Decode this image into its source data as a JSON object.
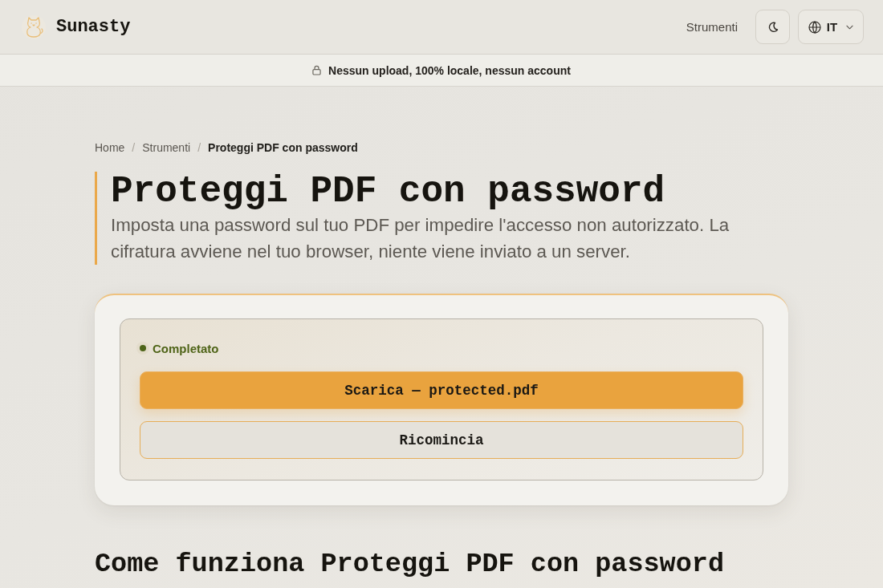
{
  "header": {
    "logo_text": "Sunasty",
    "nav_link": "Strumenti",
    "language": "IT"
  },
  "notice": "Nessun upload, 100% locale, nessun account",
  "breadcrumb": {
    "separator": "/",
    "items": [
      {
        "label": "Home",
        "current": false
      },
      {
        "label": "Strumenti",
        "current": false
      },
      {
        "label": "Proteggi PDF con password",
        "current": true
      }
    ]
  },
  "title": "Proteggi PDF con password",
  "subtitle": "Imposta una password sul tuo PDF per impedire l'accesso non autorizzato. La cifratura avviene nel tuo browser, niente viene inviato a un server.",
  "result": {
    "status": "Completato",
    "buttons": [
      {
        "label": "Scarica — protected.pdf",
        "kind": "primary"
      },
      {
        "label": "Ricomincia",
        "kind": "secondary"
      }
    ]
  },
  "section_heading": "Come funziona Proteggi PDF con password"
}
